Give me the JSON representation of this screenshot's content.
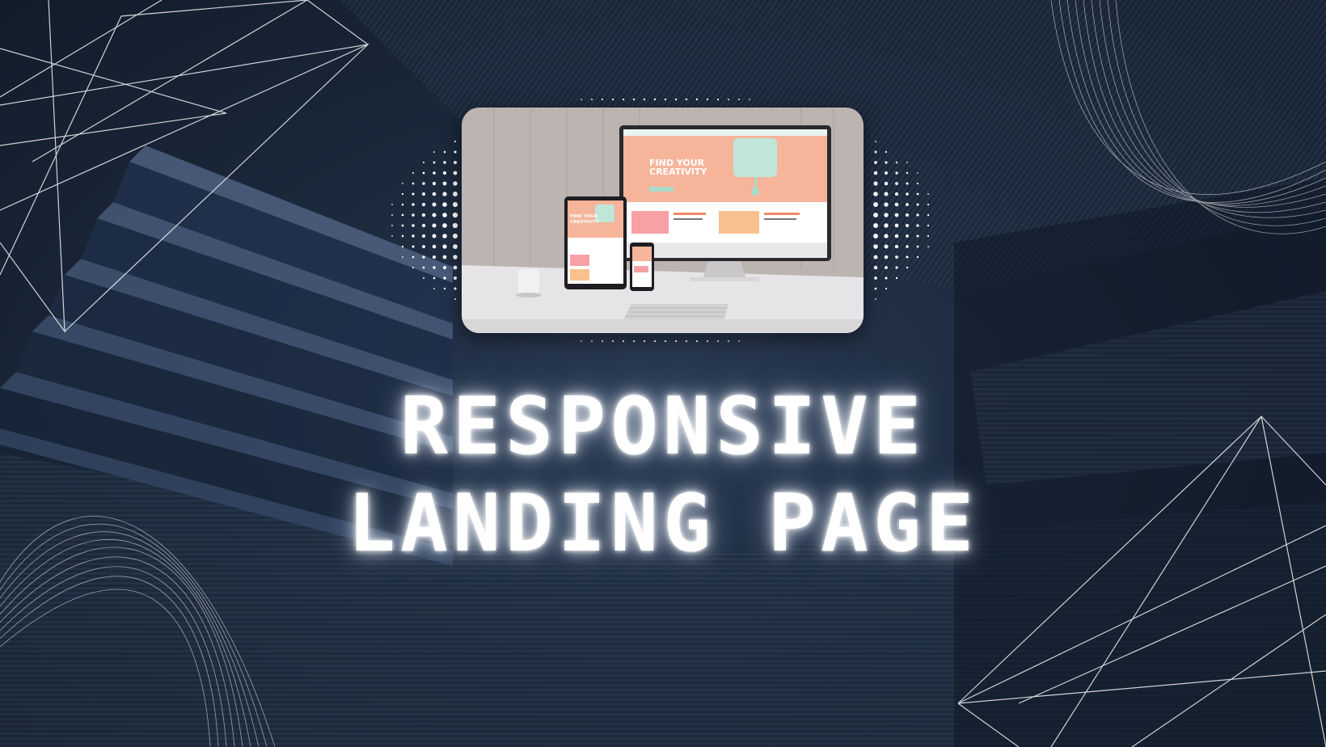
{
  "title": {
    "line1": "RESPONSIVE",
    "line2": "LANDING PAGE"
  },
  "mockup": {
    "headline_line1": "FIND YOUR",
    "headline_line2": "CREATIVITY",
    "tablet_headline_line1": "FIND YOUR",
    "tablet_headline_line2": "CREATIVITY"
  },
  "colors": {
    "background": "#1a2636",
    "accent_peach": "#f4a98c",
    "accent_mint": "#a9dccb",
    "glow": "#ffffff"
  }
}
